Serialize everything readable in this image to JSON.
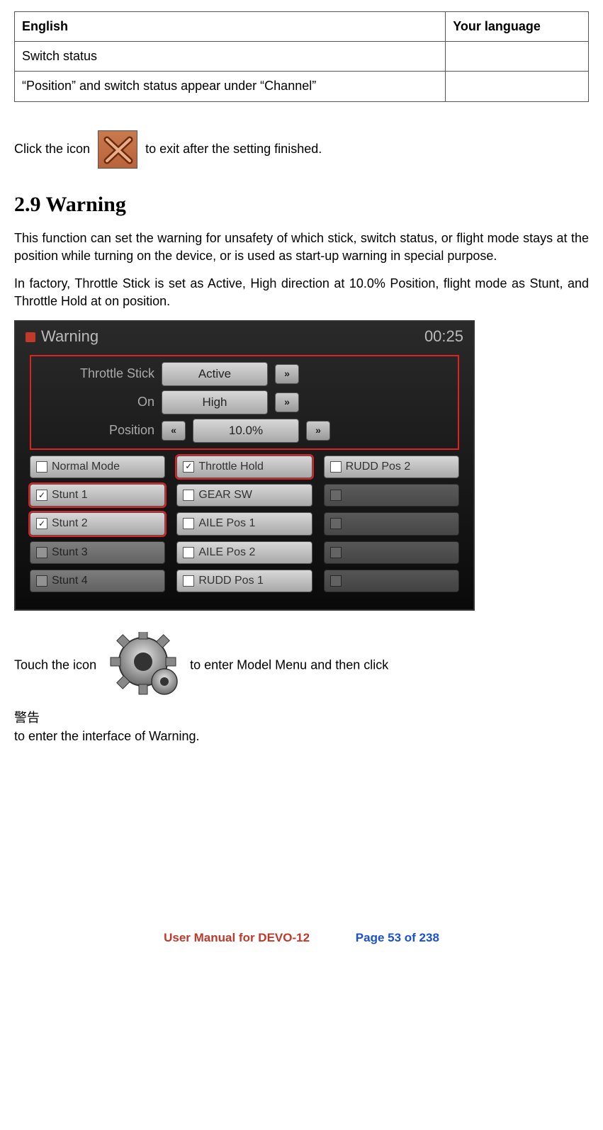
{
  "table": {
    "header_left": "English",
    "header_right": "Your language",
    "rows": [
      {
        "left": "Switch status",
        "right": ""
      },
      {
        "left": "“Position” and switch status appear under “Channel”",
        "right": ""
      }
    ]
  },
  "para_click_before": "Click the icon",
  "para_click_after": " to exit after the setting finished.",
  "section_heading": "2.9 Warning",
  "para1": "This function can set the warning for unsafety of which stick, switch status, or flight mode stays at the position while turning on the device, or is used as start-up warning in special purpose.",
  "para2": "In factory, Throttle Stick is set as Active, High direction at 10.0% Position, flight mode as Stunt, and Throttle Hold at on position.",
  "screen": {
    "title": "Warning",
    "time": "00:25",
    "rows": {
      "throttle_label": "Throttle Stick",
      "throttle_value": "Active",
      "on_label": "On",
      "on_value": "High",
      "position_label": "Position",
      "position_value": "10.0%"
    },
    "options_col1": [
      "Normal Mode",
      "Stunt 1",
      "Stunt 2",
      "Stunt 3",
      "Stunt 4"
    ],
    "options_col1_checked": [
      false,
      true,
      true,
      false,
      false
    ],
    "options_col1_red": [
      false,
      true,
      true,
      false,
      false
    ],
    "options_col1_dim": [
      false,
      false,
      false,
      true,
      true
    ],
    "options_col2": [
      "Throttle Hold",
      "GEAR SW",
      "AILE Pos 1",
      "AILE Pos 2",
      "RUDD Pos 1"
    ],
    "options_col2_checked": [
      true,
      false,
      false,
      false,
      false
    ],
    "options_col2_red": [
      true,
      false,
      false,
      false,
      false
    ],
    "options_col3": [
      "RUDD Pos 2",
      "",
      "",
      "",
      ""
    ],
    "options_col3_dim": [
      false,
      true,
      true,
      true,
      true
    ]
  },
  "para_touch_a": "Touch the icon ",
  "para_touch_b": " to enter Model Menu and then click ",
  "para_touch_c": " to enter the interface of Warning.",
  "warn_icon_label": "警告",
  "footer": {
    "title": "User Manual for DEVO-12",
    "page": "Page 53 of 238"
  }
}
